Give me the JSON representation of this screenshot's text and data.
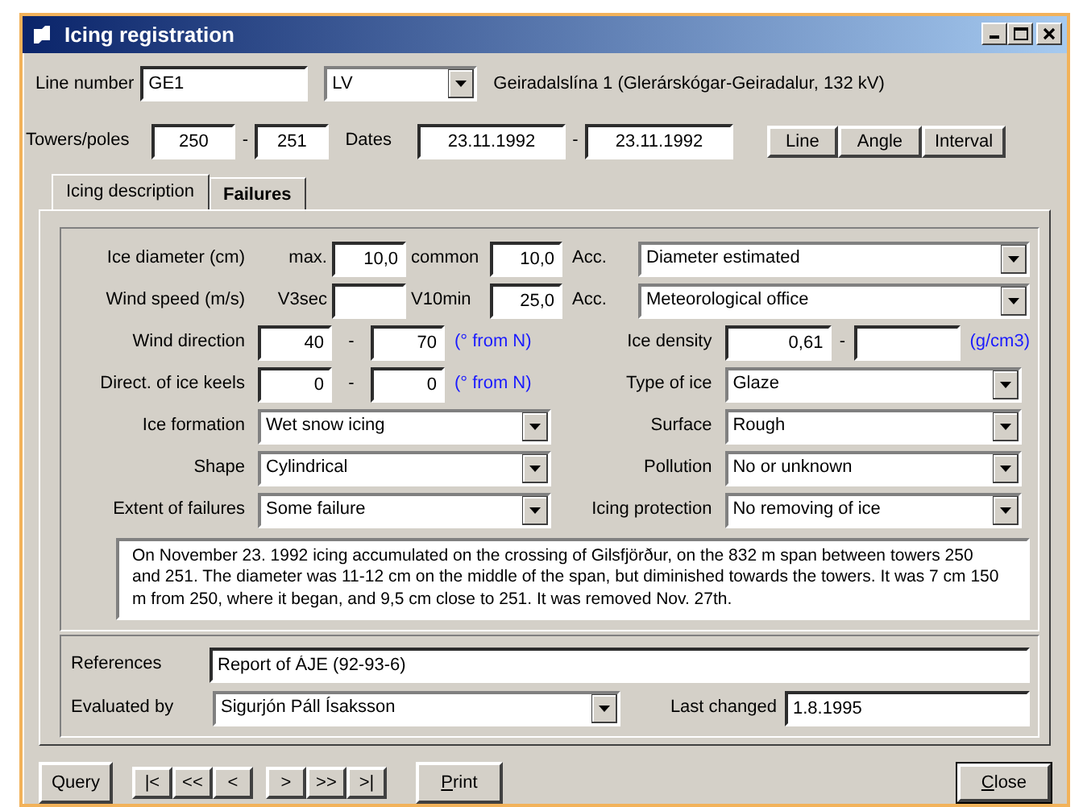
{
  "window": {
    "title": "Icing registration"
  },
  "header": {
    "line_label": "Line number",
    "line_number": "GE1",
    "line_code": "LV",
    "line_name": "Geiradalslína 1 (Glerárskógar-Geiradalur, 132 kV)",
    "towers_label": "Towers/poles",
    "tower_from": "250",
    "tower_sep": "-",
    "tower_to": "251",
    "dates_label": "Dates",
    "date_from": "23.11.1992",
    "date_sep": "-",
    "date_to": "23.11.1992",
    "buttons": [
      "Line",
      "Angle",
      "Interval"
    ]
  },
  "tabs": [
    {
      "label": "Icing description",
      "selected": true,
      "has_data": false
    },
    {
      "label": "Failures",
      "selected": false,
      "has_data": true
    }
  ],
  "measurements": [
    {
      "label": "Ice diameter (cm)",
      "sub1": "max.",
      "value1": "10,0",
      "sub2": "common",
      "value2": "10,0",
      "acc_label": "Acc.",
      "acc_value": "Diameter estimated"
    },
    {
      "label": "Wind speed (m/s)",
      "sub1": "V3sec",
      "sub2": "V10min",
      "value2": "25,0",
      "acc_label": "Acc.",
      "acc_value": "Meteorological office"
    }
  ],
  "left_fields": [
    {
      "kind": "range",
      "label": "Wind direction",
      "from": "40",
      "sep": "-",
      "to": "70",
      "unit": "(° from N)"
    },
    {
      "kind": "range",
      "label": "Direct. of ice keels",
      "from": "0",
      "sep": "-",
      "to": "0",
      "unit": "(° from N)"
    },
    {
      "kind": "select",
      "label": "Ice formation",
      "value": "Wet snow icing"
    },
    {
      "kind": "select",
      "label": "Shape",
      "value": "Cylindrical"
    },
    {
      "kind": "select",
      "label": "Extent of failures",
      "value": "Some failure"
    }
  ],
  "right_fields": [
    {
      "kind": "range",
      "label": "Ice density",
      "from": "0,61",
      "sep": "-",
      "unit": "(g/cm3)"
    },
    {
      "kind": "select",
      "label": "Type of ice",
      "value": "Glaze"
    },
    {
      "kind": "select",
      "label": "Surface",
      "value": "Rough"
    },
    {
      "kind": "select",
      "label": "Pollution",
      "value": "No or unknown"
    },
    {
      "kind": "select",
      "label": "Icing protection",
      "value": "No removing of ice"
    }
  ],
  "description": "On November 23. 1992 icing accumulated on the crossing of Gilsfjörður, on the 832 m span between towers 250 and 251. The diameter was 11-12 cm on the middle of the span, but diminished towards the towers. It was 7 cm 150 m from 250, where it began, and 9,5 cm close to 251. It was removed Nov. 27th.",
  "references": {
    "label": "References",
    "value": "Report of ÁJE (92-93-6)"
  },
  "evaluated": {
    "label": "Evaluated by",
    "value": "Sigurjón Páll Ísaksson"
  },
  "last_changed": {
    "label": "Last changed",
    "value": "1.8.1995"
  },
  "footer": {
    "query": {
      "label": "Query",
      "underline_first": false,
      "default": false
    },
    "nav_groups": [
      [
        "|<",
        "<<",
        "<"
      ],
      [
        ">",
        ">>",
        ">|"
      ]
    ],
    "print": {
      "label": "Print",
      "underline_first": true,
      "default": false
    },
    "close": {
      "label": "Close",
      "underline_first": true,
      "default": true
    }
  }
}
